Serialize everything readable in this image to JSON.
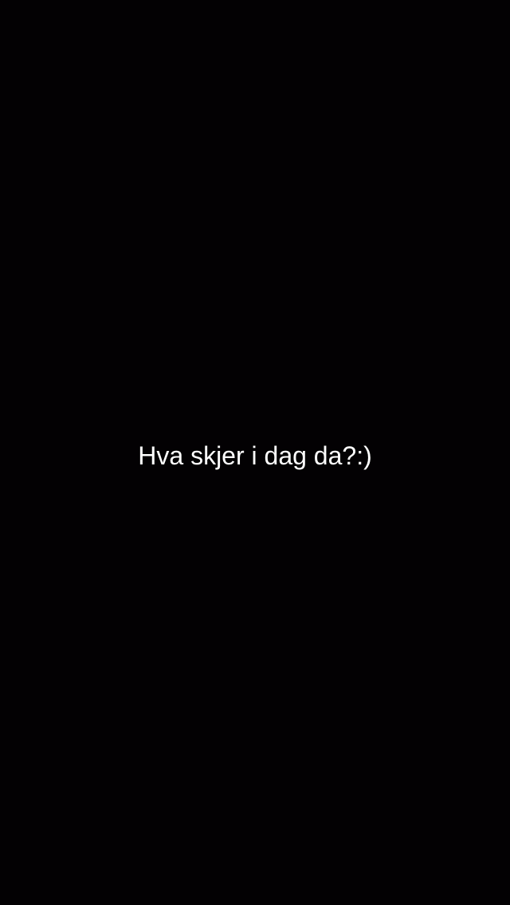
{
  "caption": {
    "text": "Hva skjer i dag da?:)"
  },
  "colors": {
    "background": "#030103",
    "caption_text": "#ffffff"
  }
}
